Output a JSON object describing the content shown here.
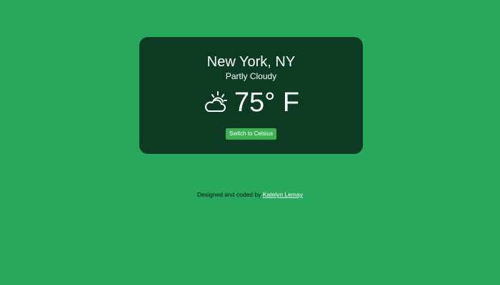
{
  "weather": {
    "location": "New York, NY",
    "condition": "Partly Cloudy",
    "temperature": "75° F",
    "icon": "partly-cloudy-icon",
    "switch_label": "Switch to Celsius"
  },
  "footer": {
    "prefix": "Designed and coded by ",
    "author": "Katelyn Lemay"
  },
  "colors": {
    "background": "#27a85d",
    "card": "#0d3a22",
    "button": "#3fb055"
  }
}
